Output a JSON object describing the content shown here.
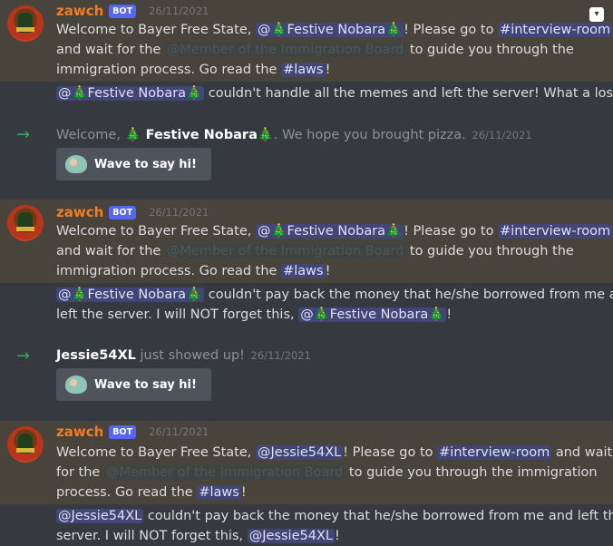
{
  "messages": [
    {
      "author": "zawch",
      "tag": "BOT",
      "time": "26/11/2021",
      "welcome_prefix": "Welcome to Bayer Free State, ",
      "mention": "@🎄Festive Nobara🎄",
      "mid": "! Please go to ",
      "channel": "#interview-room",
      "line2_pre": "and wait for the ",
      "role": "@Member of the Immigration Board",
      "line2_post": " to guide you through the",
      "line3_pre": "immigration process. Go read the ",
      "laws": "#laws",
      "line3_post": "!",
      "follow_mention": "@🎄Festive Nobara🎄",
      "follow_text": " couldn't handle all the memes and left the server! What a loser..."
    },
    {
      "author": "zawch",
      "tag": "BOT",
      "time": "26/11/2021",
      "welcome_prefix": "Welcome to Bayer Free State, ",
      "mention": "@🎄Festive Nobara🎄",
      "mid": "! Please go to ",
      "channel": "#interview-room",
      "line2_pre": "and wait for the ",
      "role": "@Member of the Immigration Board",
      "line2_post": " to guide you through the",
      "line3_pre": "immigration process. Go read the ",
      "laws": "#laws",
      "line3_post": "!",
      "follow_mention": "@🎄Festive Nobara🎄",
      "follow_text1": " couldn't pay back the money that he/she borrowed from me and",
      "follow_text2_pre": "left the server. I will NOT forget this, ",
      "follow_mention2": "@🎄Festive Nobara🎄",
      "follow_text2_post": "!"
    },
    {
      "author": "zawch",
      "tag": "BOT",
      "time": "26/11/2021",
      "welcome_prefix": "Welcome to Bayer Free State, ",
      "mention": "@Jessie54XL",
      "mid": "! Please go to ",
      "channel": "#interview-room",
      "line1_post": " and wait",
      "line2_pre": "for the ",
      "role": "@Member of the Immigration Board",
      "line2_post": " to guide you through the immigration",
      "line3_pre": "process. Go read the ",
      "laws": "#laws",
      "line3_post": "!",
      "follow_mention": "@Jessie54XL",
      "follow_text1": " couldn't pay back the money that he/she borrowed from me and left the",
      "follow_text2_pre": "server. I will NOT forget this, ",
      "follow_mention2": "@Jessie54XL",
      "follow_text2_post": "!"
    }
  ],
  "system": [
    {
      "prefix": "Welcome, ",
      "name": "🎄 Festive Nobara🎄",
      "suffix": ". We hope you brought pizza.",
      "time": "26/11/2021",
      "button": "Wave to say hi!"
    },
    {
      "name": "Jessie54XL",
      "suffix": " just showed up!",
      "time": "26/11/2021",
      "button": "Wave to say hi!"
    }
  ],
  "icons": {
    "arrow": "join-arrow-icon",
    "menu": "message-menu-icon"
  },
  "colors": {
    "author": "#f27d24",
    "bot_tag": "#5865f2",
    "join_arrow": "#3ba55d",
    "highlight": "#48433b"
  }
}
